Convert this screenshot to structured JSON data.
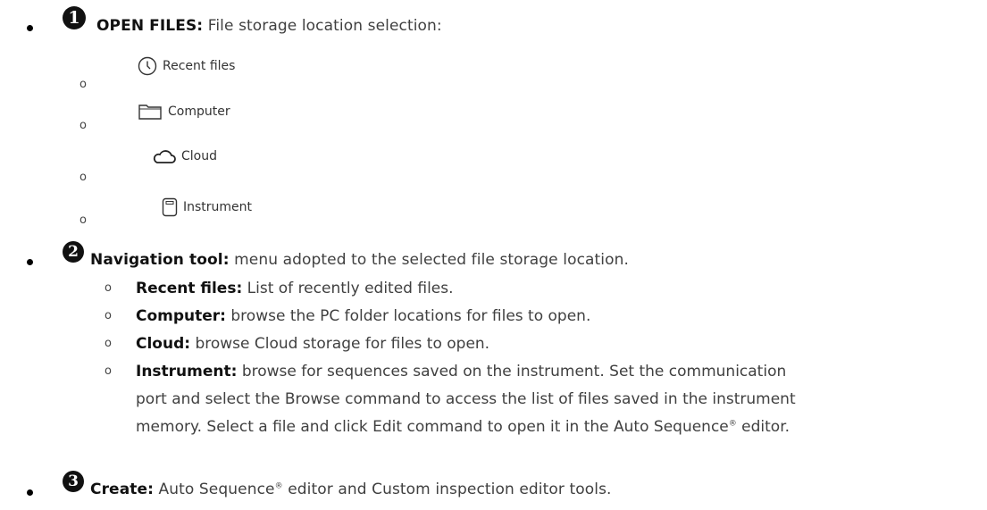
{
  "item1": {
    "number": "1",
    "title": "OPEN FILES:",
    "text": "File storage location selection:",
    "locations": [
      {
        "label": "Recent files",
        "icon": "clock-icon"
      },
      {
        "label": "Computer",
        "icon": "folder-icon"
      },
      {
        "label": "Cloud",
        "icon": "cloud-icon"
      },
      {
        "label": "Instrument",
        "icon": "instrument-icon"
      }
    ]
  },
  "item2": {
    "number": "2",
    "title": "Navigation tool:",
    "text": "menu adopted to the selected file storage location.",
    "subitems": [
      {
        "term": "Recent files:",
        "text": "List of recently edited files."
      },
      {
        "term": "Computer:",
        "text": "browse the PC folder locations for files to open."
      },
      {
        "term": "Cloud:",
        "text": "browse Cloud storage for files to open."
      },
      {
        "term": "Instrument:",
        "text": "browse for sequences saved on the instrument. Set the communication",
        "line2": "port and select the Browse command to access the list of files saved in the instrument",
        "line3_pre": "memory. Select a file and click Edit command to open it in the Auto Sequence",
        "line3_sup": "®",
        "line3_post": " editor."
      }
    ]
  },
  "item3": {
    "number": "3",
    "title": "Create:",
    "text_pre": "Auto Sequence",
    "sup": "®",
    "text_post": " editor and Custom inspection editor tools."
  },
  "bullets": {
    "main": "•",
    "sub": "o"
  }
}
